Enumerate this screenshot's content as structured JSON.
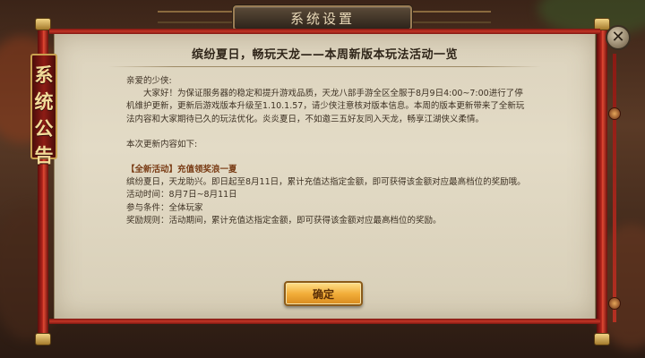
{
  "window": {
    "title": "系统设置"
  },
  "banner": {
    "chars": [
      "系",
      "统",
      "公",
      "告"
    ]
  },
  "close": {
    "glyph": "✕"
  },
  "notice": {
    "heading": "缤纷夏日，畅玩天龙——本周新版本玩法活动一览",
    "greeting": "亲爱的少侠:",
    "intro": "大家好！为保证服务器的稳定和提升游戏品质，天龙八部手游全区全服于8月9日4:00~7:00进行了停机维护更新，更新后游戏版本升级至1.10.1.57，请少侠注意核对版本信息。本周的版本更新带来了全新玩法内容和大家期待已久的玩法优化。炎炎夏日，不如邀三五好友同入天龙，畅享江湖侠义柔情。",
    "update_header": "本次更新内容如下:",
    "activity_title": "【全新活动】充值领奖浪一夏",
    "activity_desc": "缤纷夏日，天龙助兴。即日起至8月11日，累计充值达指定金额，即可获得该金额对应最高档位的奖励哦。",
    "activity_time": "活动时间：8月7日~8月11日",
    "activity_condition": "参与条件：全体玩家",
    "activity_rules": "奖励规则：活动期间，累计充值达指定金额，即可获得该金额对应最高档位的奖励。"
  },
  "buttons": {
    "confirm": "确定"
  },
  "colors": {
    "parchment": "#e3dbc6",
    "rod_red": "#b2241c",
    "gold": "#f2ae3a"
  }
}
